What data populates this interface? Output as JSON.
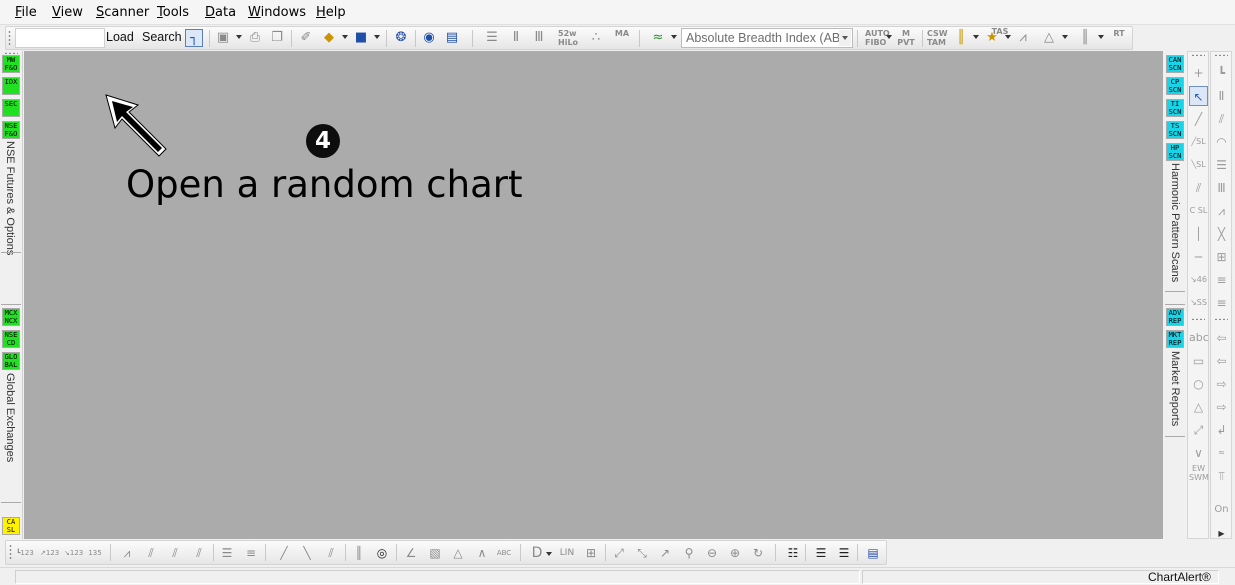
{
  "menu": {
    "items": [
      "File",
      "View",
      "Scanner",
      "Tools",
      "Data",
      "Windows",
      "Help"
    ]
  },
  "toolbar": {
    "symbol_value": "",
    "load_label": "Load",
    "search_label": "Search",
    "indicator_value": "Absolute Breadth Index (ABI",
    "tiny_labels": {
      "hilo": "52w\nHiLo",
      "ma": "MA",
      "auto_fibo": "AUTO\nFIBO",
      "pvt": "M\nPVT",
      "csw_tam": "CSW\nTAM",
      "tas": "TAS",
      "rt": "RT"
    }
  },
  "chart": {
    "step_number": "4",
    "callout": "Open a random chart",
    "background": "#ababab"
  },
  "left_panel": {
    "group1_buttons": [
      "MW\nF&O",
      "IDX",
      "SEC",
      "NSE\nF&O"
    ],
    "group1_title": "NSE Futures & Options",
    "group2_buttons": [
      "MCX\nNCX",
      "NSE\nCD",
      "GLO\nBAL"
    ],
    "group2_title": "Global Exchanges",
    "group3_buttons": [
      "CA\nSL"
    ]
  },
  "right_panel": {
    "group1_buttons": [
      "CAN\nSCN",
      "CP\nSCN",
      "TI\nSCN",
      "TS\nSCN",
      "HP\nSCN"
    ],
    "group1_title": "Harmonic Pattern Scans",
    "group2_buttons": [
      "ADV\nREP",
      "MKT\nREP"
    ],
    "group2_title": "Market Reports"
  },
  "drawing_tools": {
    "abc_label": "abc",
    "ew_label": "EW\nSWM",
    "on_label": "On"
  },
  "bottom_toolbar": {
    "d_label": "D",
    "lin_label": "LIN",
    "abc_label": "ABC"
  },
  "status": {
    "brand": "ChartAlert®"
  },
  "colors": {
    "chart_bg": "#ababab",
    "green_btn": "#21e021",
    "cyan_btn": "#19d3e6",
    "yellow_btn": "#fff200"
  }
}
